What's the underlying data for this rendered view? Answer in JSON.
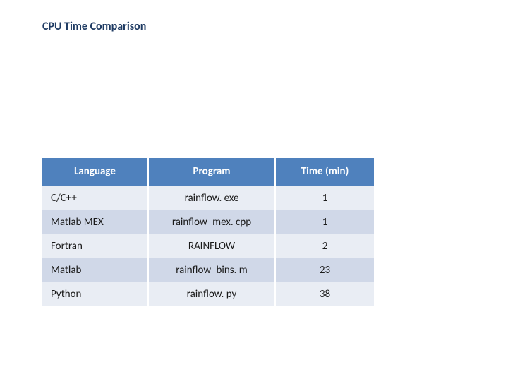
{
  "title": "CPU Time Comparison",
  "table": {
    "headers": {
      "language": "Language",
      "program": "Program",
      "time": "Time  (min)"
    },
    "rows": [
      {
        "language": "C/C++",
        "program": "rainflow. exe",
        "time": "1"
      },
      {
        "language": "Matlab MEX",
        "program": "rainflow_mex. cpp",
        "time": "1"
      },
      {
        "language": "Fortran",
        "program": "RAINFLOW",
        "time": "2"
      },
      {
        "language": "Matlab",
        "program": "rainflow_bins. m",
        "time": "23"
      },
      {
        "language": "Python",
        "program": "rainflow. py",
        "time": "38"
      }
    ]
  },
  "chart_data": {
    "type": "table",
    "title": "CPU Time Comparison",
    "columns": [
      "Language",
      "Program",
      "Time (min)"
    ],
    "rows": [
      [
        "C/C++",
        "rainflow.exe",
        1
      ],
      [
        "Matlab MEX",
        "rainflow_mex.cpp",
        1
      ],
      [
        "Fortran",
        "RAINFLOW",
        2
      ],
      [
        "Matlab",
        "rainflow_bins.m",
        23
      ],
      [
        "Python",
        "rainflow.py",
        38
      ]
    ]
  }
}
